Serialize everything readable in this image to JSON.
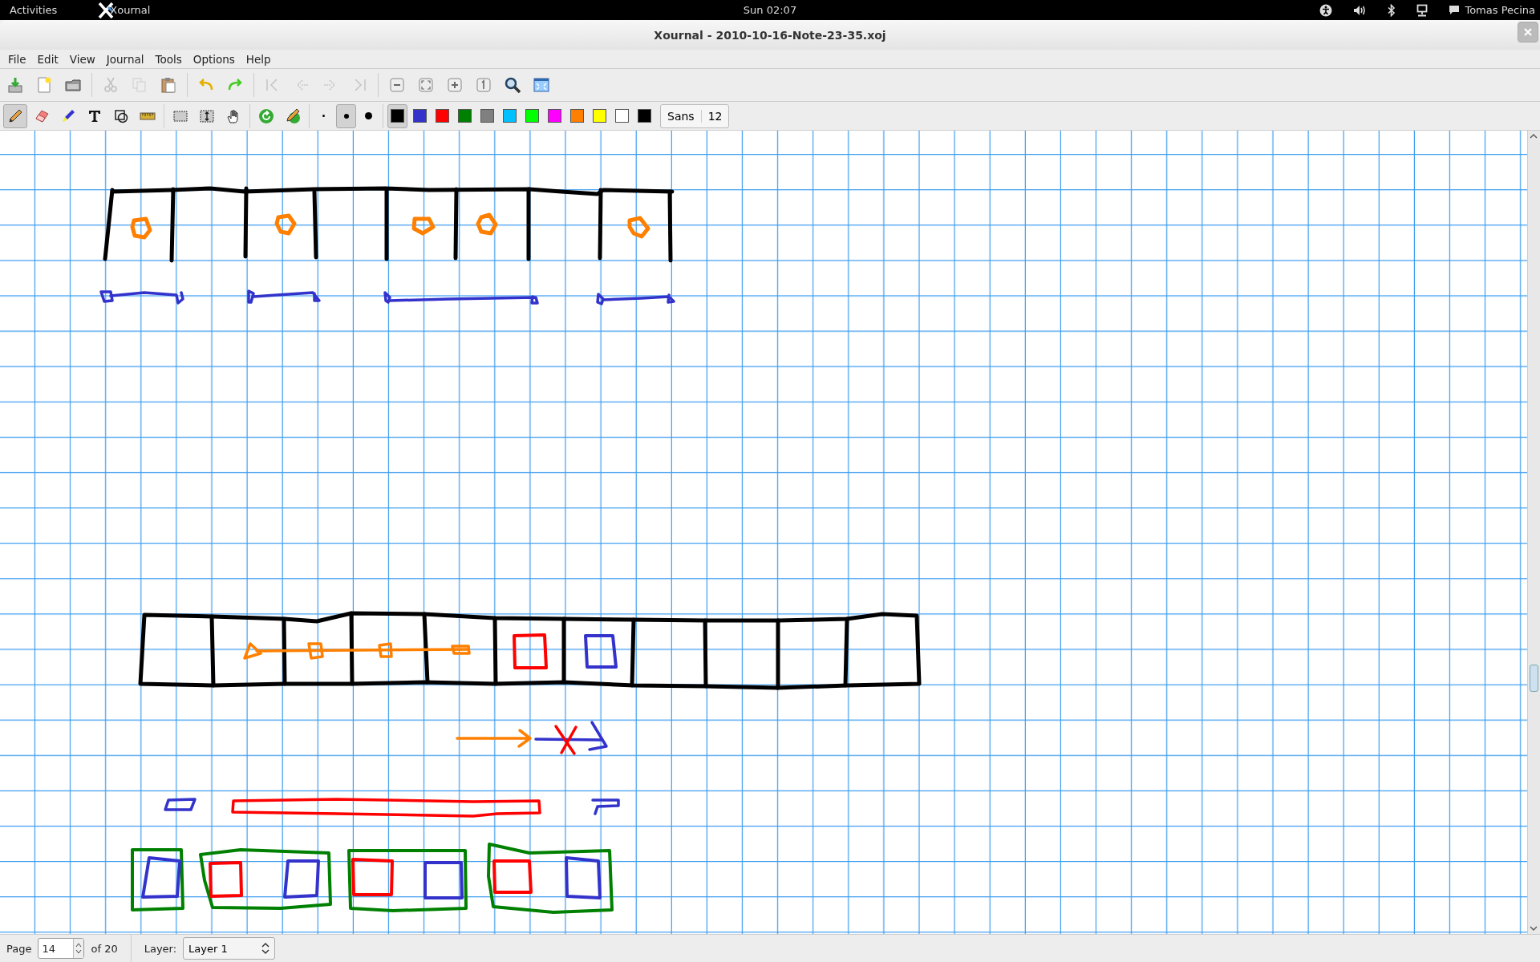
{
  "top_bar": {
    "activities": "Activities",
    "app_name": "Xournal",
    "clock": "Sun 02:07",
    "user": "Tomas Pecina"
  },
  "window": {
    "title": "Xournal - 2010-10-16-Note-23-35.xoj"
  },
  "menu": [
    "File",
    "Edit",
    "View",
    "Journal",
    "Tools",
    "Options",
    "Help"
  ],
  "main_toolbar": [
    {
      "disabled": false
    },
    {
      "disabled": false
    },
    {
      "disabled": false
    },
    {
      "disabled": true
    },
    {
      "disabled": true
    },
    {
      "disabled": false
    },
    {
      "disabled": false
    },
    {
      "disabled": false
    },
    {
      "disabled": true
    },
    {
      "disabled": true
    },
    {
      "disabled": true
    },
    {
      "disabled": true
    },
    {
      "disabled": false
    },
    {
      "disabled": false
    },
    {
      "disabled": false
    },
    {
      "disabled": false
    },
    {
      "disabled": false
    },
    {
      "disabled": false
    }
  ],
  "tools": [
    {
      "selected": true
    },
    {
      "selected": false
    },
    {
      "selected": false
    },
    {
      "selected": false
    },
    {
      "selected": false
    },
    {
      "selected": false
    },
    {
      "selected": false
    },
    {
      "selected": false
    },
    {
      "selected": false
    }
  ],
  "thickness": [
    {
      "selected": false
    },
    {
      "selected": true
    },
    {
      "selected": false
    }
  ],
  "colors": [
    {
      "color": "#000000",
      "selected": true
    },
    {
      "color": "#3333cc",
      "selected": false
    },
    {
      "color": "#ff0000",
      "selected": false
    },
    {
      "color": "#008000",
      "selected": false
    },
    {
      "color": "#808080",
      "selected": false
    },
    {
      "color": "#00c0ff",
      "selected": false
    },
    {
      "color": "#00ff00",
      "selected": false
    },
    {
      "color": "#ff00ff",
      "selected": false
    },
    {
      "color": "#ff8000",
      "selected": false
    },
    {
      "color": "#ffff00",
      "selected": false
    },
    {
      "color": "#ffffff",
      "selected": false
    },
    {
      "color": "#000000",
      "selected": false
    }
  ],
  "font": {
    "name": "Sans",
    "size": "12"
  },
  "status_bar": {
    "page_label": "Page",
    "page": "14",
    "page_total": "of 20",
    "layer_label": "Layer:",
    "layer": "Layer 1"
  }
}
